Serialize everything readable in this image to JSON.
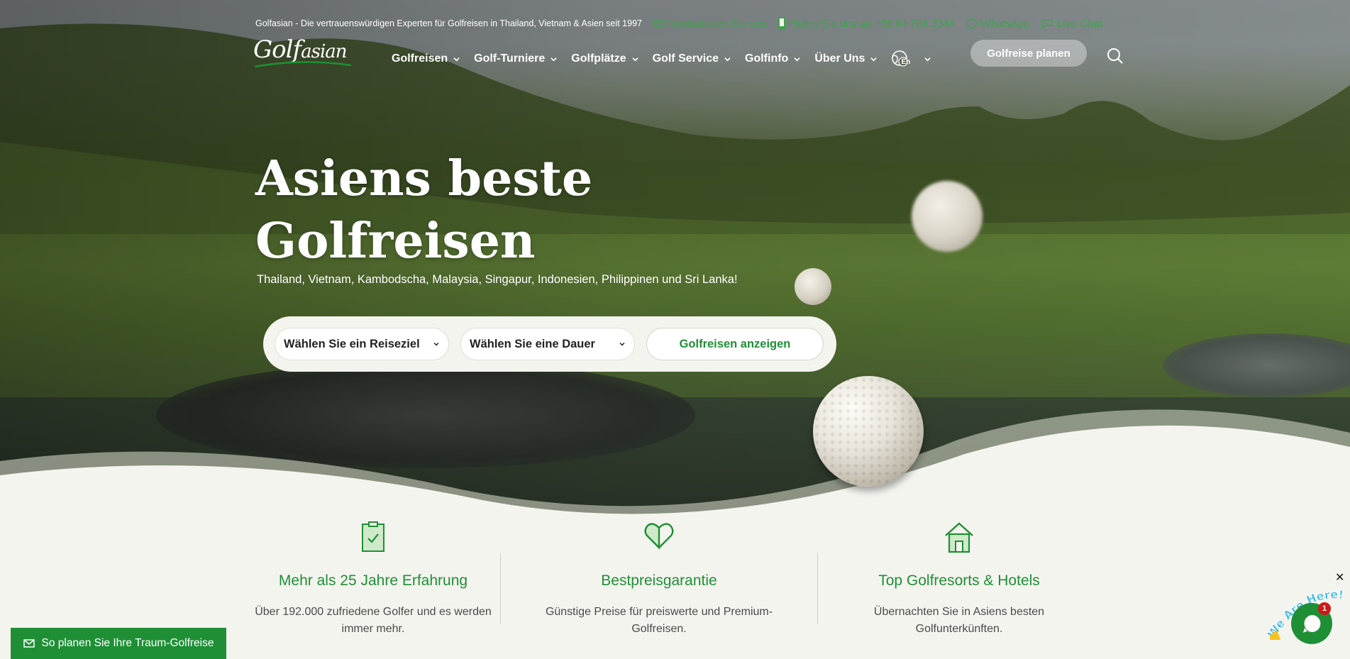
{
  "topbar": {
    "tagline": "Golfasian - Die vertrauenswürdigen Experten für Golfreisen in Thailand, Vietnam & Asien seit 1997",
    "contact": "Kontaktieren Sie uns",
    "call": "Rufen Sie uns an +66 84 704 3344",
    "whatsapp": "WhatsApp",
    "livechat": "Live-Chat"
  },
  "logo": {
    "text_main": "Golf",
    "text_rest": "asian"
  },
  "nav": {
    "items": [
      "Golfreisen",
      "Golf-Turniere",
      "Golfplätze",
      "Golf Service",
      "Golfinfo",
      "Über Uns"
    ],
    "language": "En",
    "plan_button": "Golfreise planen"
  },
  "hero": {
    "title_line1": "Asiens beste",
    "title_line2": "Golfreisen",
    "subtitle": "Thailand, Vietnam, Kambodscha, Malaysia, Singapur, Indonesien, Philippinen und Sri Lanka!"
  },
  "search": {
    "destination": "Wählen Sie ein Reiseziel",
    "duration": "Wählen Sie eine Dauer",
    "submit": "Golfreisen anzeigen"
  },
  "features": [
    {
      "icon": "clipboard-check-icon",
      "title": "Mehr als 25 Jahre Erfahrung",
      "desc": "Über 192.000 zufriedene Golfer und es werden immer mehr."
    },
    {
      "icon": "heart-icon",
      "title": "Bestpreisgarantie",
      "desc": "Günstige Preise für preiswerte und Premium-Golfreisen."
    },
    {
      "icon": "house-icon",
      "title": "Top Golfresorts & Hotels",
      "desc": "Übernachten Sie in Asiens besten Golfunterkünften."
    }
  ],
  "floating": {
    "plan_cta": "So planen Sie Ihre Traum-Golfreise",
    "chat_badge": "We Are Here!",
    "chat_count": "1",
    "close": "✕"
  },
  "colors": {
    "brand_green": "#1f8f36",
    "link_green": "#3ea34d",
    "page_bg": "#f4f4ef"
  }
}
